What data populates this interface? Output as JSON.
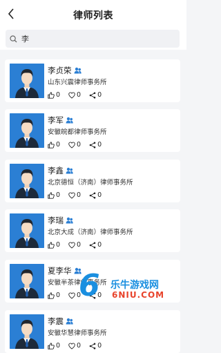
{
  "header": {
    "title": "律师列表",
    "back_icon": "chevron-left-icon"
  },
  "search": {
    "value": "李",
    "icon": "search-icon"
  },
  "lawyers": [
    {
      "name": "李贞荣",
      "firm": "山东兴震律师事务所",
      "likes": "0",
      "favorites": "0",
      "shares": "0"
    },
    {
      "name": "李军",
      "firm": "安徽皖都律师事务所",
      "likes": "0",
      "favorites": "0",
      "shares": "0"
    },
    {
      "name": "李鑫",
      "firm": "北京德恒（济南）律师事务所",
      "likes": "0",
      "favorites": "0",
      "shares": "0"
    },
    {
      "name": "李瑞",
      "firm": "北京大成（济南）律师事务所",
      "likes": "0",
      "favorites": "0",
      "shares": "0"
    },
    {
      "name": "夏李华",
      "firm": "安徽半茶律师事务所",
      "likes": "0",
      "favorites": "0",
      "shares": "0"
    },
    {
      "name": "李震",
      "firm": "安徽华慧律师事务所",
      "likes": "0",
      "favorites": "0",
      "shares": "0"
    }
  ],
  "watermark": {
    "text": "乐牛游戏网",
    "url": "6NIU.COM",
    "logo": "6"
  },
  "colors": {
    "accent": "#2b7fd4",
    "background": "#f4f5f7"
  }
}
